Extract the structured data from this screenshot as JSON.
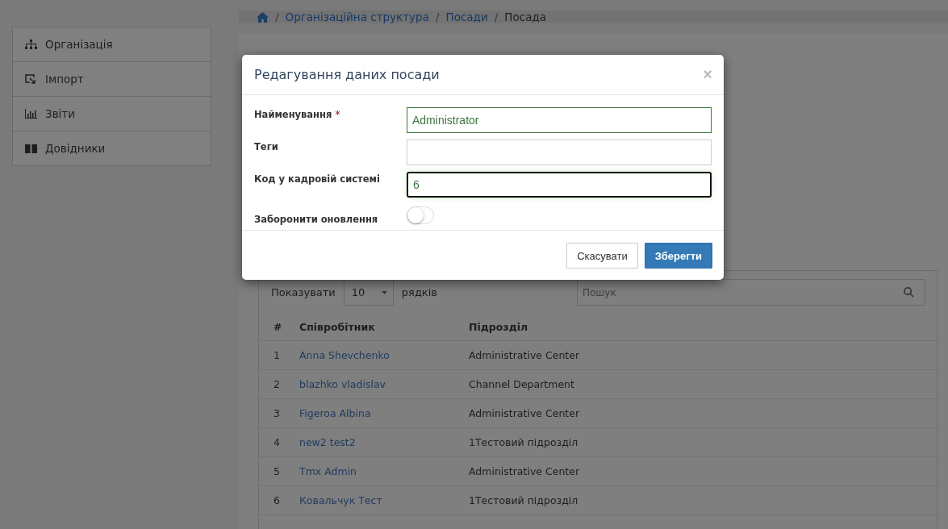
{
  "breadcrumb": [
    {
      "kind": "home"
    },
    {
      "kind": "separator",
      "label": "/"
    },
    {
      "kind": "link",
      "label": "Організаційна структура"
    },
    {
      "kind": "separator",
      "label": "/"
    },
    {
      "kind": "link",
      "label": "Посади"
    },
    {
      "kind": "separator",
      "label": "/"
    },
    {
      "kind": "current",
      "label": "Посада"
    }
  ],
  "sidebar": {
    "items": [
      {
        "kind": "org",
        "label": "Організація"
      },
      {
        "kind": "import",
        "label": "Імпорт"
      },
      {
        "kind": "chart",
        "label": "Звіти"
      },
      {
        "kind": "book",
        "label": "Довідники"
      }
    ]
  },
  "table": {
    "show_label": "Показувати",
    "page_size": "10",
    "rows_label": "рядків",
    "search": {
      "placeholder": "Пошук"
    },
    "columns": [
      "#",
      "Співробітник",
      "Підрозділ"
    ],
    "rows": [
      [
        "1",
        "Anna Shevchenko",
        "Administrative Center"
      ],
      [
        "2",
        "blazhko vladislav",
        "Channel Department"
      ],
      [
        "3",
        "Figeroa Albina",
        "Administrative Center"
      ],
      [
        "4",
        "new2 test2",
        "1Тестовий підрозділ"
      ],
      [
        "5",
        "Tmx Admin",
        "Administrative Center"
      ],
      [
        "6",
        "Ковальчук Тест",
        "1Тестовий підрозділ"
      ]
    ]
  },
  "modal": {
    "title": "Редагування даних посади",
    "close": "×",
    "fields": [
      {
        "kind": "text",
        "label": "Найменування",
        "marker": "*",
        "value": "Administrator",
        "valid": true,
        "focused": false
      },
      {
        "kind": "text",
        "label": "Теги",
        "valid": false,
        "focused": false
      },
      {
        "kind": "text",
        "label": "Код у кадровій системі",
        "value": "6",
        "valid": true,
        "focused": true
      },
      {
        "kind": "toggle",
        "label": "Заборонити оновлення",
        "on": false
      }
    ],
    "buttons": [
      {
        "kind": "default",
        "label": "Скасувати"
      },
      {
        "kind": "primary",
        "label": "Зберегти"
      }
    ]
  }
}
